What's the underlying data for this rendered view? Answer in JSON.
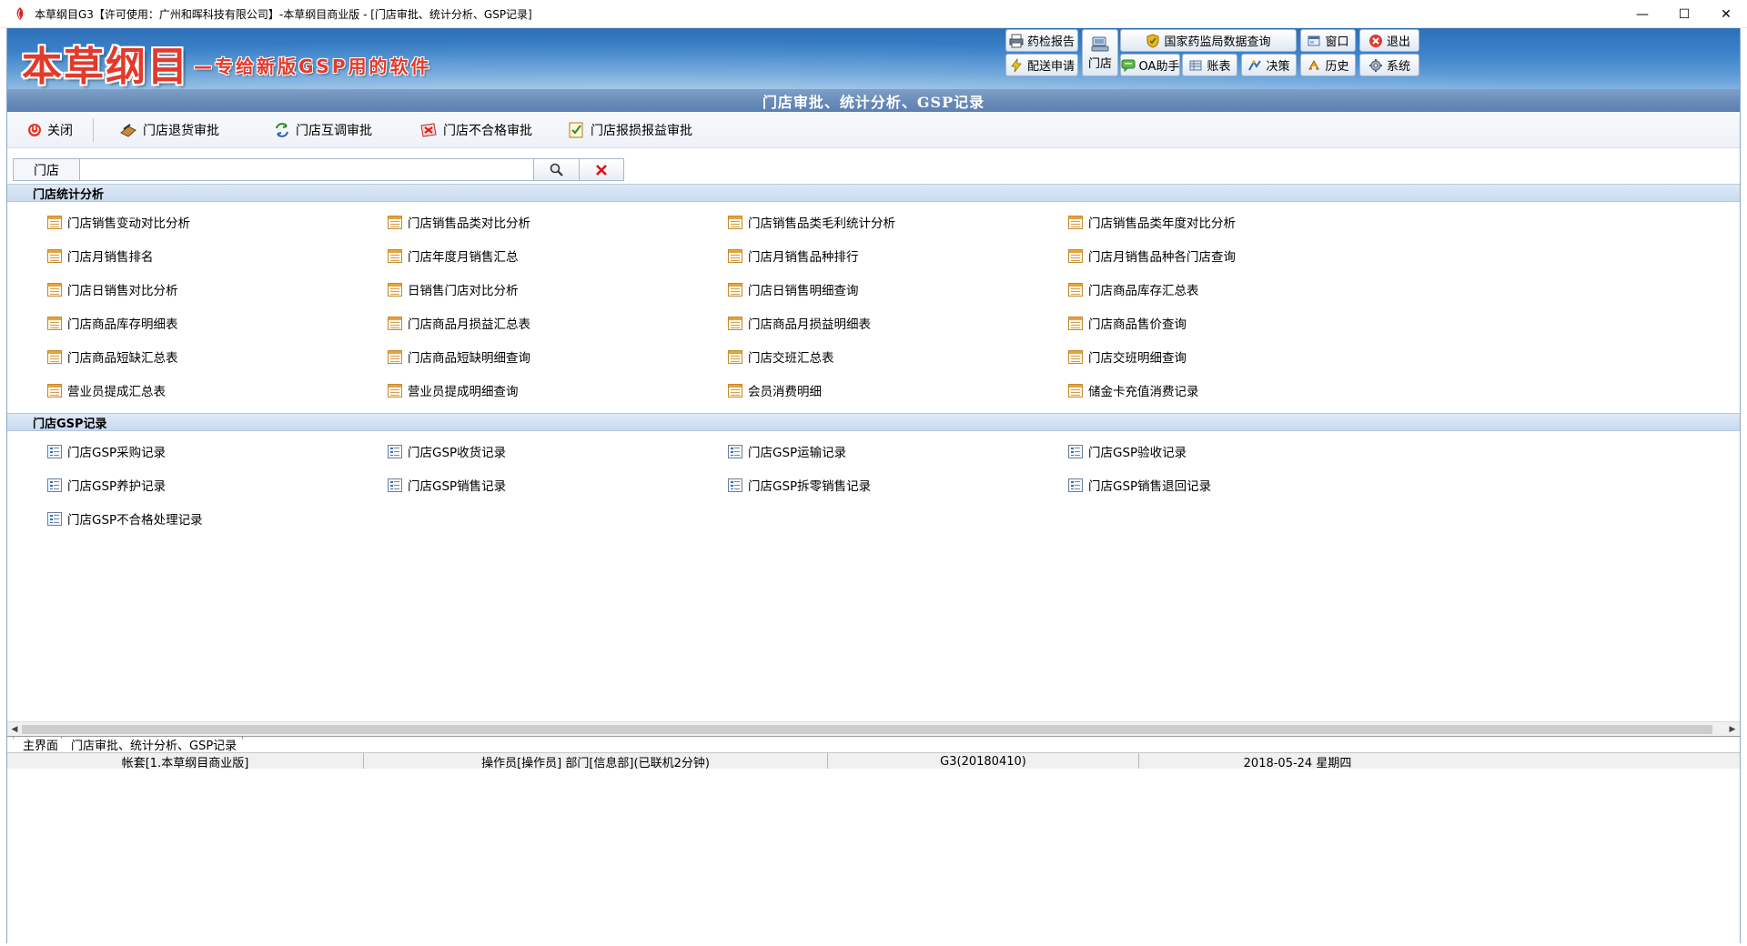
{
  "window": {
    "title": "本草纲目G3【许可使用：广州和晖科技有限公司】-本草纲目商业版 - [门店审批、统计分析、GSP记录]",
    "minimize": "—",
    "maximize": "☐",
    "close": "✕"
  },
  "banner": {
    "logo_main": "本草纲目",
    "logo_sub": "—专给新版GSP用的软件"
  },
  "header_buttons": {
    "drug_report": "药检报告",
    "delivery_request": "配送申请",
    "store": "门店",
    "national_query": "国家药监局数据查询",
    "oa_assistant": "OA助手",
    "ledger": "账表",
    "window": "窗口",
    "exit": "退出",
    "history": "历史",
    "decision": "决策",
    "system": "系统"
  },
  "page_title": "门店审批、统计分析、GSP记录",
  "toolbar": {
    "close": "关闭",
    "return_approval": "门店退货审批",
    "transfer_approval": "门店互调审批",
    "unqualified_approval": "门店不合格审批",
    "lossgain_approval": "门店报损报益审批"
  },
  "search": {
    "label": "门店",
    "value": "",
    "placeholder": ""
  },
  "sections": {
    "stats": {
      "title": "门店统计分析",
      "items": [
        "门店销售变动对比分析",
        "门店销售品类对比分析",
        "门店销售品类毛利统计分析",
        "门店销售品类年度对比分析",
        "门店月销售排名",
        "门店年度月销售汇总",
        "门店月销售品种排行",
        "门店月销售品种各门店查询",
        "门店日销售对比分析",
        "日销售门店对比分析",
        "门店日销售明细查询",
        "门店商品库存汇总表",
        "门店商品库存明细表",
        "门店商品月损益汇总表",
        "门店商品月损益明细表",
        "门店商品售价查询",
        "门店商品短缺汇总表",
        "门店商品短缺明细查询",
        "门店交班汇总表",
        "门店交班明细查询",
        "营业员提成汇总表",
        "营业员提成明细查询",
        "会员消费明细",
        "储金卡充值消费记录"
      ]
    },
    "gsp": {
      "title": "门店GSP记录",
      "items": [
        "门店GSP采购记录",
        "门店GSP收货记录",
        "门店GSP运输记录",
        "门店GSP验收记录",
        "门店GSP养护记录",
        "门店GSP销售记录",
        "门店GSP拆零销售记录",
        "门店GSP销售退回记录",
        "门店GSP不合格处理记录"
      ]
    }
  },
  "tabs": [
    "主界面",
    "门店审批、统计分析、GSP记录"
  ],
  "status": {
    "account": "帐套[1.本草纲目商业版]",
    "operator": "操作员[操作员] 部门[信息部](已联机2分钟)",
    "version": "G3(20180410)",
    "date": "2018-05-24 星期四"
  },
  "colors": {
    "banner_blue": "#3b82c9",
    "logo_red": "#e23a2c",
    "strip_blue": "#6a8dbb",
    "section_blue": "#c9daf0",
    "clear_red": "#d11"
  }
}
